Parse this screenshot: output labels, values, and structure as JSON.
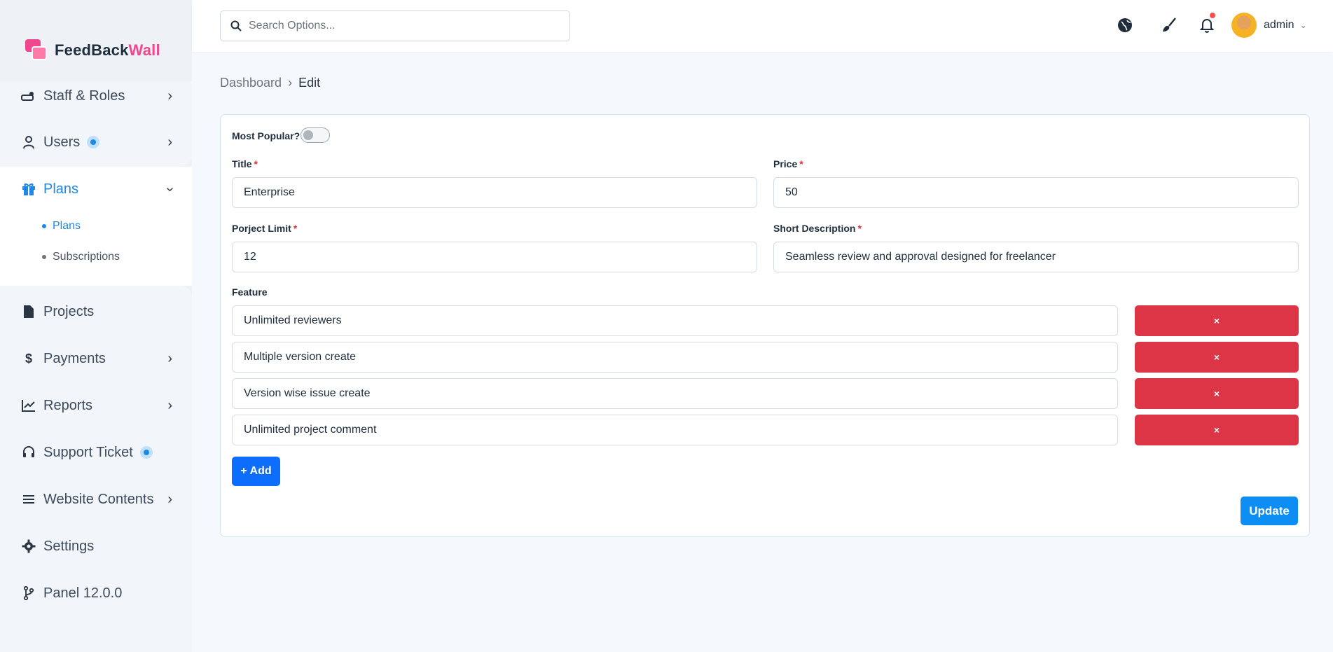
{
  "app": {
    "logo_part1": "FeedBack",
    "logo_part2": "Wall"
  },
  "sidebar": {
    "items": [
      {
        "label": "Staff & Roles",
        "icon": "staff-icon"
      },
      {
        "label": "Users",
        "icon": "user-icon"
      },
      {
        "label": "Plans",
        "icon": "gift-icon"
      },
      {
        "label": "Projects",
        "icon": "file-icon"
      },
      {
        "label": "Payments",
        "icon": "dollar-icon"
      },
      {
        "label": "Reports",
        "icon": "chart-line-icon"
      },
      {
        "label": "Support Ticket",
        "icon": "headset-icon"
      },
      {
        "label": "Website Contents",
        "icon": "list-icon"
      },
      {
        "label": "Settings",
        "icon": "gear-icon"
      },
      {
        "label": "Panel 12.0.0",
        "icon": "branch-icon"
      }
    ],
    "sub_items": [
      {
        "label": "Plans"
      },
      {
        "label": "Subscriptions"
      }
    ],
    "active_color": "#1e88e5"
  },
  "topbar": {
    "search_placeholder": "Search Options...",
    "user_name": "admin",
    "notification_color": "#ff4d4f"
  },
  "breadcrumb": {
    "root": "Dashboard",
    "current": "Edit"
  },
  "form": {
    "popular_label": "Most Popular?",
    "popular_on": false,
    "title_label": "Title",
    "title_value": "Enterprise",
    "price_label": "Price",
    "price_value": "50",
    "limit_label": "Porject Limit",
    "limit_value": "12",
    "desc_label": "Short Description",
    "desc_value": "Seamless review and approval designed for freelancer",
    "feature_label": "Feature",
    "features": [
      "Unlimited reviewers",
      "Multiple version create",
      "Version wise issue create",
      "Unlimited project comment"
    ],
    "delete_label": "×",
    "add_label": "+ Add",
    "update_label": "Update",
    "required_mark": "*"
  },
  "colors": {
    "danger": "#dc3545",
    "primary": "#0d6efd",
    "update": "#0d8ef5",
    "brand_pink": "#f0478f"
  }
}
